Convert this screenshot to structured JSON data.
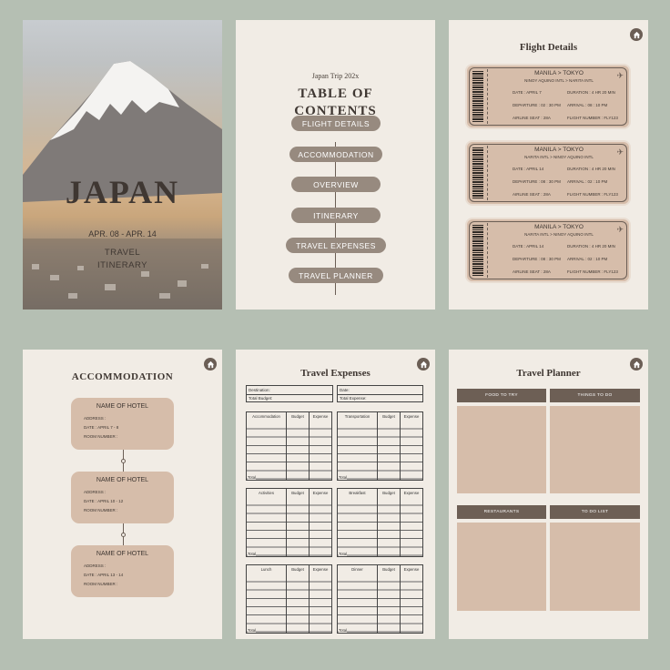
{
  "cover": {
    "title": "JAPAN",
    "dates": "APR. 08 - APR. 14",
    "line1": "TRAVEL",
    "line2": "ITINERARY"
  },
  "toc": {
    "kicker": "Japan Trip 202x",
    "title1": "TABLE OF",
    "title2": "CONTENTS",
    "items": [
      "FLIGHT DETAILS",
      "ACCOMMODATION",
      "OVERVIEW",
      "ITINERARY",
      "TRAVEL EXPENSES",
      "TRAVEL PLANNER"
    ]
  },
  "flight": {
    "title": "Flight Details",
    "tickets": [
      {
        "route": "MANILA > TOKYO",
        "airports": "NINOY AQUINO INTL > NARITA INTL",
        "date": "DATE : APRIL 7",
        "duration": "DURATION : 4 HR 20 MIN",
        "departure": "DEPARTURE : 02 : 30 PM",
        "arrival": "ARRIVAL : 08 : 10 PM",
        "seat": "AIRLINE SEAT : 28A",
        "flight": "FLIGHT NUMBER : FLY123"
      },
      {
        "route": "MANILA > TOKYO",
        "airports": "NARITA INTL > NINOY AQUINO INTL",
        "date": "DATE : APRIL 14",
        "duration": "DURATION : 4 HR 20 MIN",
        "departure": "DEPARTURE : 08 : 30 PM",
        "arrival": "ARRIVAL : 02 : 10 PM",
        "seat": "AIRLINE SEAT : 28A",
        "flight": "FLIGHT NUMBER : FLY123"
      },
      {
        "route": "MANILA > TOKYO",
        "airports": "NARITA INTL > NINOY AQUINO INTL",
        "date": "DATE : APRIL 14",
        "duration": "DURATION : 4 HR 20 MIN",
        "departure": "DEPARTURE : 08 : 30 PM",
        "arrival": "ARRIVAL : 02 : 10 PM",
        "seat": "AIRLINE SEAT : 28A",
        "flight": "FLIGHT NUMBER : FLY123"
      }
    ]
  },
  "accommodation": {
    "title": "ACCOMMODATION",
    "hotels": [
      {
        "name": "NAME OF HOTEL",
        "address": "ADDRESS :",
        "date": "DATE : APRIL 7 - 8",
        "room": "ROOM NUMBER :"
      },
      {
        "name": "NAME OF HOTEL",
        "address": "ADDRESS :",
        "date": "DATE : APRIL 10 - 12",
        "room": "ROOM NUMBER :"
      },
      {
        "name": "NAME OF HOTEL",
        "address": "ADDRESS :",
        "date": "DATE : APRIL 13 - 14",
        "room": "ROOM NUMBER :"
      }
    ]
  },
  "expenses": {
    "title": "Travel Expenses",
    "destination": "Destination:",
    "date": "Date:",
    "total_budget": "Total Budget:",
    "total_expense": "Total Expense:",
    "col_budget": "Budget",
    "col_expense": "Expense",
    "total": "Total",
    "tables": [
      "Accommodation",
      "Transportation",
      "Activities",
      "Breakfast",
      "Lunch",
      "Dinner"
    ]
  },
  "planner": {
    "title": "Travel Planner",
    "sections": [
      "FOOD TO TRY",
      "THINGS TO DO",
      "RESTAURANTS",
      "TO DO LIST"
    ]
  },
  "colors": {
    "page": "#f1ece5",
    "accent": "#6d5f55",
    "tan": "#d6bdaa",
    "pill": "#978a7f",
    "background": "#b5bfb3"
  },
  "icons": {
    "home": "home-icon",
    "plane": "airplane-icon",
    "barcode": "barcode-icon"
  }
}
